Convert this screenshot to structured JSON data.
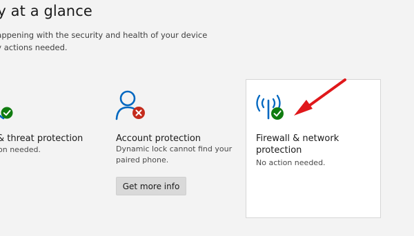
{
  "header": {
    "title": "ty at a glance",
    "subtitle_line1": "happening with the security and health of your device",
    "subtitle_line2": "ny actions needed."
  },
  "tiles": [
    {
      "icon": "shield-check-icon",
      "title": "& threat protection",
      "description": "on needed."
    },
    {
      "icon": "account-warning-icon",
      "title": "Account protection",
      "description_line1": "Dynamic lock cannot find your",
      "description_line2": "paired phone.",
      "button_label": "Get more info"
    },
    {
      "icon": "firewall-network-icon",
      "title_line1": "Firewall & network",
      "title_line2": "protection",
      "description": "No action needed."
    }
  ],
  "colors": {
    "accent": "#0067c0",
    "success": "#107c10",
    "error": "#c42b1c",
    "annotation_arrow": "#e0181b"
  }
}
